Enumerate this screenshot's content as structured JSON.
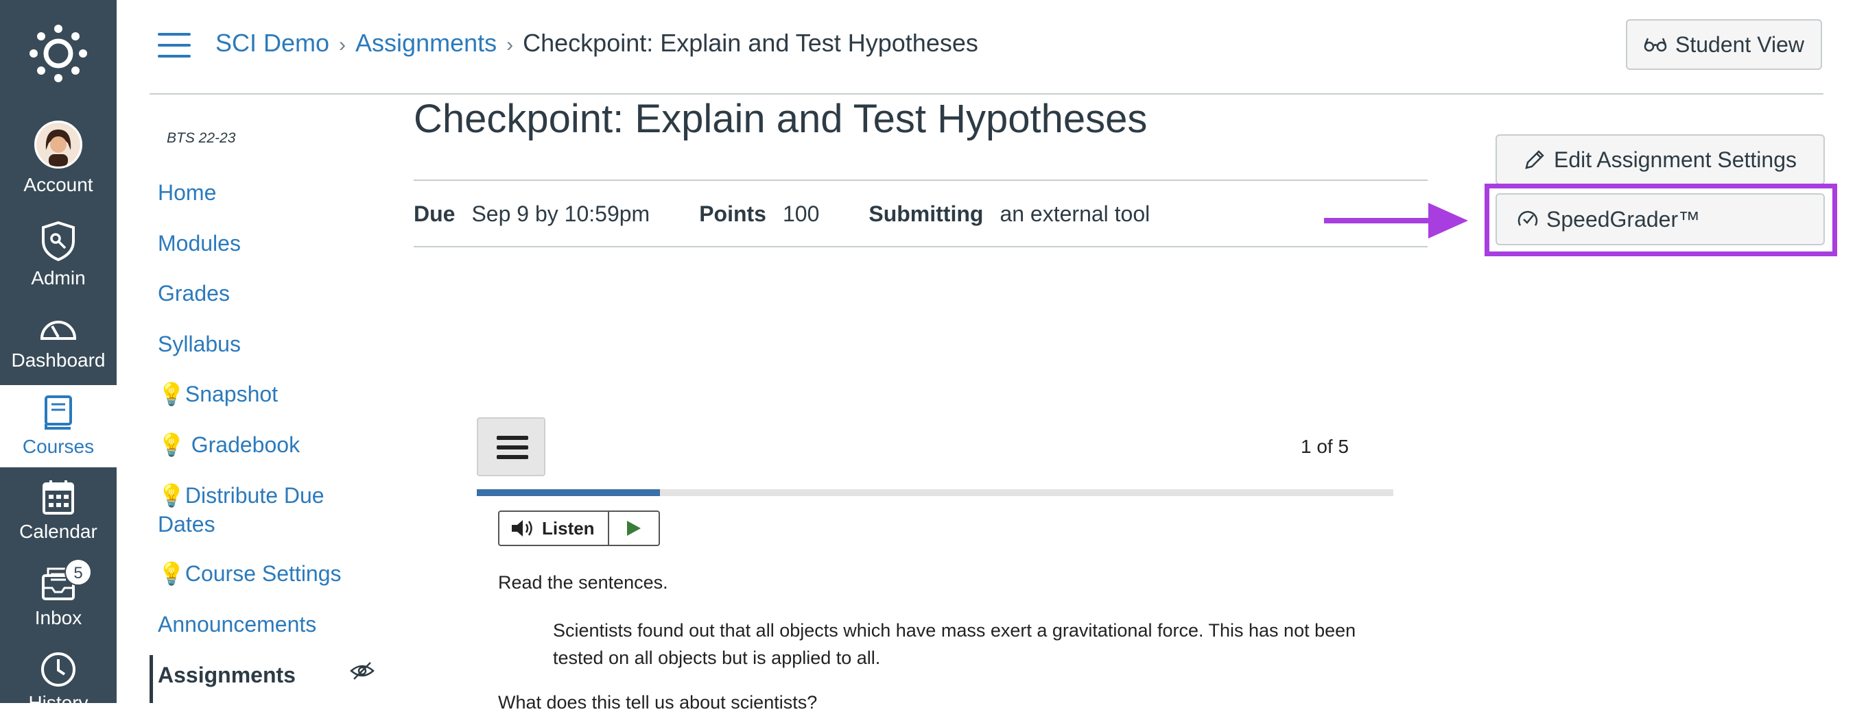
{
  "global_nav": {
    "account": "Account",
    "admin": "Admin",
    "dashboard": "Dashboard",
    "courses": "Courses",
    "calendar": "Calendar",
    "inbox": "Inbox",
    "inbox_badge": "5",
    "history": "History"
  },
  "breadcrumb": {
    "course": "SCI Demo",
    "section": "Assignments",
    "current": "Checkpoint: Explain and Test Hypotheses"
  },
  "header": {
    "student_view": "Student View"
  },
  "course_nav": {
    "term": "BTS 22-23",
    "items": [
      {
        "label": "Home"
      },
      {
        "label": "Modules"
      },
      {
        "label": "Grades"
      },
      {
        "label": "Syllabus"
      },
      {
        "label": "💡Snapshot"
      },
      {
        "label": "💡 Gradebook"
      },
      {
        "label": "💡Distribute Due Dates"
      },
      {
        "label": "💡Course Settings"
      },
      {
        "label": "Announcements"
      },
      {
        "label": "Assignments"
      }
    ]
  },
  "assignment": {
    "title": "Checkpoint: Explain and Test Hypotheses",
    "due_label": "Due",
    "due_value": "Sep 9 by 10:59pm",
    "points_label": "Points",
    "points_value": "100",
    "submitting_label": "Submitting",
    "submitting_value": "an external tool"
  },
  "actions": {
    "edit": "Edit Assignment Settings",
    "speedgrader": "SpeedGrader™"
  },
  "colors": {
    "highlight": "#a83ee0",
    "link": "#2b7abc",
    "nav_bg": "#394b58"
  },
  "tool": {
    "pager": "1 of 5",
    "progress": 0.2,
    "listen": "Listen",
    "prompt": "Read the sentences.",
    "quote": "Scientists found out that all objects which have mass exert a gravitational force. This has not been tested on all objects but is applied to all.",
    "question": "What does this tell us about scientists?"
  }
}
